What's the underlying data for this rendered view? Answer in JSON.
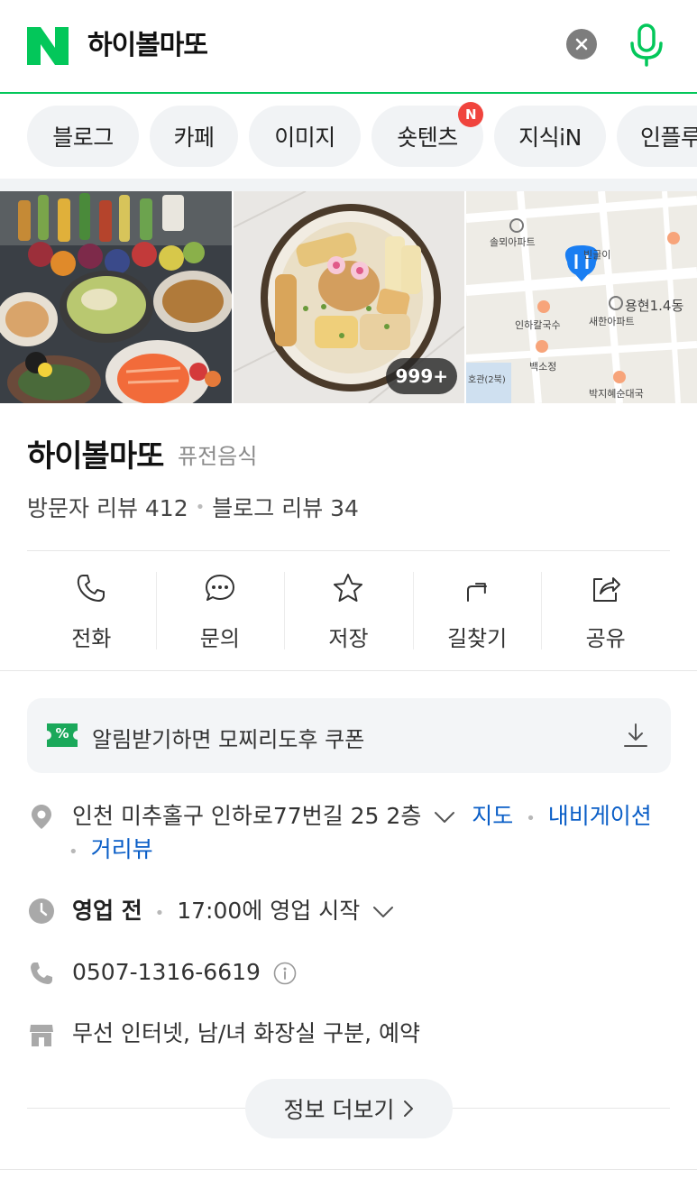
{
  "search": {
    "query": "하이볼마또",
    "logo_letter": "N",
    "brand_color": "#03c75a"
  },
  "tabs": [
    {
      "label": "블로그"
    },
    {
      "label": "카페"
    },
    {
      "label": "이미지"
    },
    {
      "label": "숏텐츠",
      "badge": "N"
    },
    {
      "label": "지식iN"
    },
    {
      "label": "인플루"
    }
  ],
  "photos": {
    "count_badge": "999+",
    "map_labels": {
      "apt1": "솔뫼아파트",
      "food1": "빈글이",
      "dong": "용현1.4동",
      "restaurant1": "인하칼국수",
      "apt2": "새한아파트",
      "restaurant2": "백소정",
      "hall": "호관(2북)",
      "restaurant3": "박지혜순대국"
    }
  },
  "place": {
    "name": "하이볼마또",
    "category": "퓨전음식",
    "visitor_reviews": "방문자 리뷰 412",
    "blog_reviews": "블로그 리뷰 34"
  },
  "actions": [
    {
      "label": "전화",
      "icon": "phone-icon"
    },
    {
      "label": "문의",
      "icon": "chat-icon"
    },
    {
      "label": "저장",
      "icon": "star-icon"
    },
    {
      "label": "길찾기",
      "icon": "directions-icon"
    },
    {
      "label": "공유",
      "icon": "share-icon"
    }
  ],
  "coupon": {
    "text": "알림받기하면 모찌리도후 쿠폰",
    "badge": "%"
  },
  "info": {
    "address": "인천 미추홀구 인하로77번길 25 2층",
    "map_link": "지도",
    "navigation_link": "내비게이션",
    "street_view_link": "거리뷰",
    "hours_status": "영업 전",
    "hours_detail": "17:00에 영업 시작",
    "phone": "0507-1316-6619",
    "amenities": "무선 인터넷, 남/녀 화장실 구분, 예약"
  },
  "more_button": "정보 더보기"
}
